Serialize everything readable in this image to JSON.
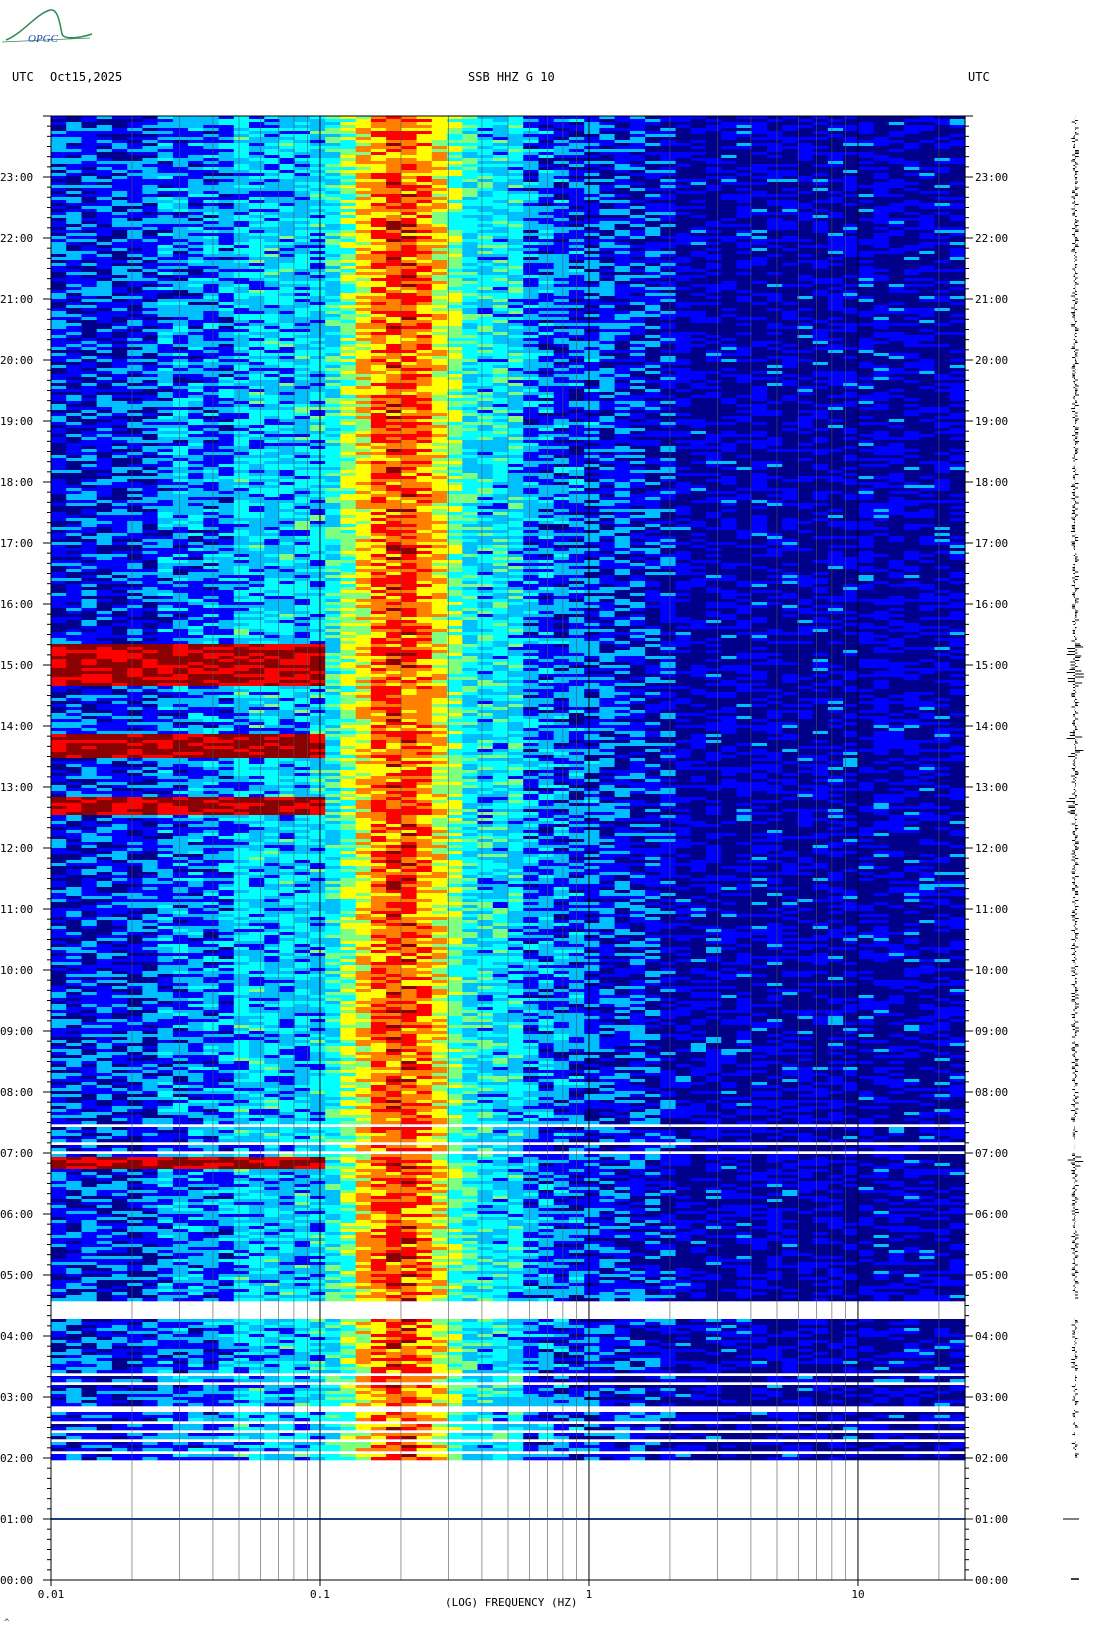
{
  "header": {
    "tz_left": "UTC",
    "date": "Oct15,2025",
    "station": "SSB HHZ G 10",
    "tz_right": "UTC"
  },
  "logo": {
    "text": "OPGC"
  },
  "chart_data": {
    "type": "heatmap",
    "title": "SSB HHZ G 10",
    "xlabel": "(LOG) FREQUENCY (HZ)",
    "x_scale": "log",
    "xlim": [
      0.01,
      25
    ],
    "x_ticks": [
      {
        "value": 0.01,
        "label": "0.01"
      },
      {
        "value": 0.1,
        "label": "0.1"
      },
      {
        "value": 1,
        "label": "1"
      },
      {
        "value": 10,
        "label": "10"
      }
    ],
    "ylabel": "UTC",
    "y_ticks": [
      "00:00",
      "01:00",
      "02:00",
      "03:00",
      "04:00",
      "05:00",
      "06:00",
      "07:00",
      "08:00",
      "09:00",
      "10:00",
      "11:00",
      "12:00",
      "13:00",
      "14:00",
      "15:00",
      "16:00",
      "17:00",
      "18:00",
      "19:00",
      "20:00",
      "21:00",
      "22:00",
      "23:00"
    ],
    "ylim_hours": [
      0,
      24
    ],
    "data_start_hour": 2.0,
    "gaps_hours": [
      [
        2.08,
        2.12
      ],
      [
        2.28,
        2.35
      ],
      [
        2.43,
        2.5
      ],
      [
        2.6,
        2.65
      ],
      [
        2.8,
        2.86
      ],
      [
        3.2,
        3.27
      ],
      [
        3.35,
        3.42
      ],
      [
        4.3,
        4.6
      ],
      [
        7.0,
        7.08
      ],
      [
        7.15,
        7.22
      ],
      [
        7.45,
        7.52
      ]
    ],
    "colormap": [
      "#00008b",
      "#0000ff",
      "#00bfff",
      "#00ffff",
      "#7fff7f",
      "#ffff00",
      "#ff8000",
      "#ff0000",
      "#8b0000"
    ],
    "microseism_peak_hz": 0.2,
    "events_hours": [
      {
        "start": 14.7,
        "end": 15.35,
        "low_freq_power": "high"
      },
      {
        "start": 13.5,
        "end": 13.9,
        "low_freq_power": "high"
      },
      {
        "start": 12.55,
        "end": 12.85,
        "low_freq_power": "high"
      },
      {
        "start": 6.75,
        "end": 6.95,
        "low_freq_power": "high"
      }
    ]
  }
}
